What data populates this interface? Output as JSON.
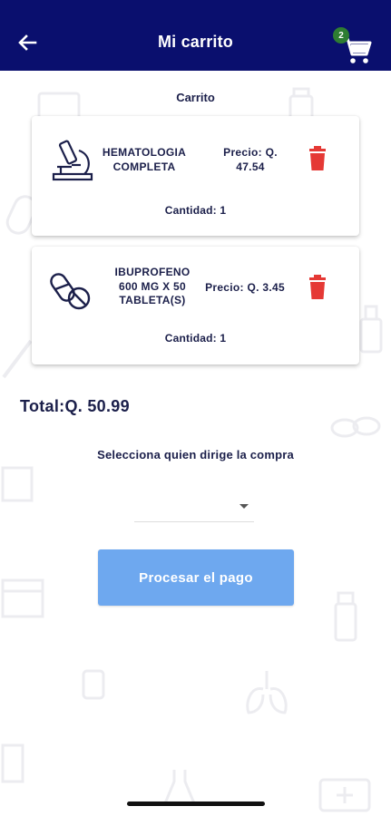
{
  "header": {
    "title": "Mi carrito",
    "back_icon": "arrow-left-icon",
    "cart_icon": "cart-icon",
    "cart_count": "2",
    "background_color": "#0a0f6e",
    "badge_color": "#2e7d32"
  },
  "cart": {
    "section_label": "Carrito",
    "items": [
      {
        "icon": "microscope-icon",
        "name": "HEMATOLOGIA COMPLETA",
        "price": "Precio: Q. 47.54",
        "quantity": "Cantidad: 1",
        "delete_icon": "trash-icon"
      },
      {
        "icon": "pills-icon",
        "name": "IBUPROFENO 600 MG  X 50 TABLETA(S)",
        "price": "Precio: Q. 3.45",
        "quantity": "Cantidad: 1",
        "delete_icon": "trash-icon"
      }
    ],
    "delete_color": "#e53935"
  },
  "total": "Total:Q. 50.99",
  "purchase": {
    "select_label": "Selecciona quien dirige la compra",
    "selected_value": "",
    "pay_button": "Procesar el pago",
    "pay_button_color": "#6ea8ef"
  }
}
